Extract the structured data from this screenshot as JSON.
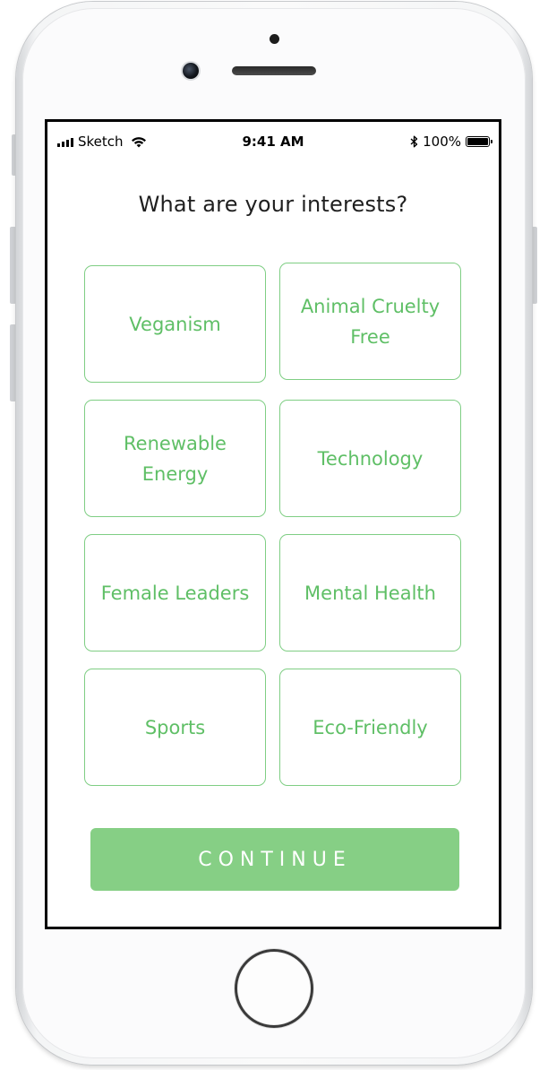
{
  "status_bar": {
    "carrier": "Sketch",
    "time": "9:41 AM",
    "battery": "100%"
  },
  "question": "What are your interests?",
  "interests": [
    {
      "label": "Veganism"
    },
    {
      "label": "Animal Cruelty Free"
    },
    {
      "label": "Renewable Energy"
    },
    {
      "label": "Technology"
    },
    {
      "label": "Female Leaders"
    },
    {
      "label": "Mental Health"
    },
    {
      "label": "Sports"
    },
    {
      "label": "Eco-Friendly"
    }
  ],
  "continue_label": "CONTINUE",
  "colors": {
    "accent": "#86cf85",
    "tile_text": "#5fbf66",
    "tile_border": "#7fce84"
  },
  "icons": {
    "signal": "cellular-signal-icon",
    "wifi": "wifi-icon",
    "bluetooth": "bluetooth-icon",
    "battery": "battery-icon"
  }
}
